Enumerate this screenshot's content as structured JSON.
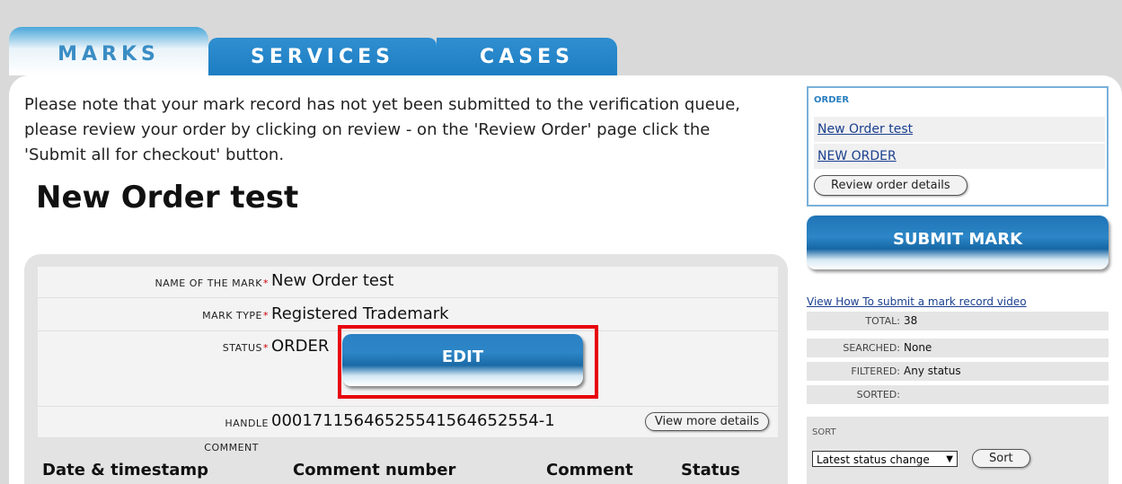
{
  "tabs": [
    {
      "label": "MARKS",
      "active": true
    },
    {
      "label": "SERVICES",
      "active": false
    },
    {
      "label": "CASES",
      "active": false
    }
  ],
  "notice": "Please note that your mark record has not yet been submitted to the verification queue, please review your order by clicking on review - on the 'Review Order' page click the 'Submit all for checkout' button.",
  "page_title": "New Order test",
  "form": {
    "name_label": "NAME OF THE MARK",
    "name_value": "New Order test",
    "type_label": "MARK TYPE",
    "type_value": "Registered Trademark",
    "status_label": "STATUS",
    "status_value": "ORDER",
    "edit_label": "EDIT",
    "handle_label": "HANDLE",
    "handle_value": "000171156465255415646525​54-1",
    "view_more_label": "View more details",
    "comment_label": "COMMENT",
    "required_mark": "*"
  },
  "comment_table": {
    "columns": [
      "Date & timestamp",
      "Comment number",
      "Comment",
      "Status"
    ]
  },
  "sidebar": {
    "order_heading": "ORDER",
    "order_links": [
      "New Order test",
      "NEW ORDER"
    ],
    "review_label": "Review order details",
    "submit_label": "SUBMIT MARK",
    "video_link": "View How To submit a mark record video",
    "stats": [
      {
        "key": "TOTAL:",
        "value": "38"
      },
      {
        "key": "SEARCHED:",
        "value": "None"
      },
      {
        "key": "FILTERED:",
        "value": "Any status"
      },
      {
        "key": "SORTED:",
        "value": ""
      }
    ],
    "sort_heading": "SORT",
    "sort_selected": "Latest status change",
    "sort_button": "Sort"
  },
  "colors": {
    "tab_blue": "#1d7dc2",
    "highlight_red": "#e8000b",
    "link_blue": "#1a3f8f"
  }
}
